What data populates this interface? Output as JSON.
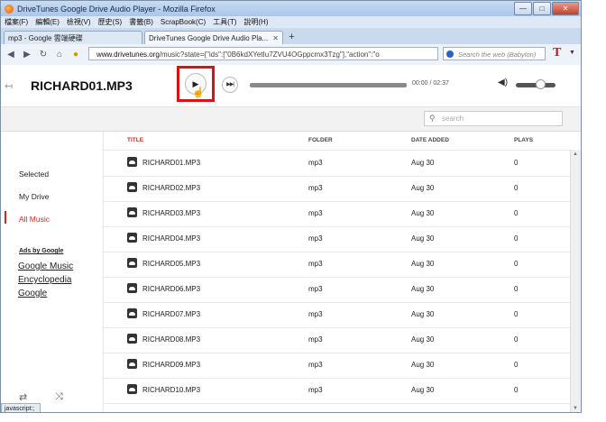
{
  "browser": {
    "window_title": "DriveTunes Google Drive Audio Player - Mozilla Firefox",
    "menu": [
      "檔案(F)",
      "編輯(E)",
      "檢視(V)",
      "歷史(S)",
      "書籤(B)",
      "ScrapBook(C)",
      "工具(T)",
      "說明(H)"
    ],
    "tabs": [
      {
        "label": "mp3 - Google 雲端硬碟"
      },
      {
        "label": "DriveTunes Google Drive Audio Pla..."
      }
    ],
    "url_domain": "www.drivetunes.org",
    "url_path": "/music?state={\"ids\":[\"0B6kdXYetIu7ZVU4OGppcmx3Tzg\"],\"action\":\"o",
    "search_placeholder": "Search the web (Babylon)",
    "status_text": "javascript:;"
  },
  "player": {
    "back_glyph": "↤",
    "song_title": "RICHARD01.MP3",
    "play_glyph": "▶",
    "next_glyph": "▶▶|",
    "time": "00:00 / 02:37",
    "progress": 0,
    "volume": 0.7,
    "volume_glyph": "◀)"
  },
  "search": {
    "placeholder": "search"
  },
  "sidebar": {
    "items": [
      {
        "label": "Selected"
      },
      {
        "label": "My Drive"
      },
      {
        "label": "All Music",
        "active": true
      }
    ],
    "ads_title": "Ads by Google",
    "ads": [
      "Google Music",
      "Encyclopedia",
      "Google"
    ],
    "repeat_glyph": "⇄",
    "shuffle_glyph": "⤨"
  },
  "table": {
    "headers": {
      "title": "TITLE",
      "folder": "FOLDER",
      "date_added": "DATE ADDED",
      "plays": "PLAYS"
    },
    "rows": [
      {
        "title": "RICHARD01.MP3",
        "folder": "mp3",
        "date": "Aug 30",
        "plays": "0"
      },
      {
        "title": "RICHARD02.MP3",
        "folder": "mp3",
        "date": "Aug 30",
        "plays": "0"
      },
      {
        "title": "RICHARD03.MP3",
        "folder": "mp3",
        "date": "Aug 30",
        "plays": "0"
      },
      {
        "title": "RICHARD04.MP3",
        "folder": "mp3",
        "date": "Aug 30",
        "plays": "0"
      },
      {
        "title": "RICHARD05.MP3",
        "folder": "mp3",
        "date": "Aug 30",
        "plays": "0"
      },
      {
        "title": "RICHARD06.MP3",
        "folder": "mp3",
        "date": "Aug 30",
        "plays": "0"
      },
      {
        "title": "RICHARD07.MP3",
        "folder": "mp3",
        "date": "Aug 30",
        "plays": "0"
      },
      {
        "title": "RICHARD08.MP3",
        "folder": "mp3",
        "date": "Aug 30",
        "plays": "0"
      },
      {
        "title": "RICHARD09.MP3",
        "folder": "mp3",
        "date": "Aug 30",
        "plays": "0"
      },
      {
        "title": "RICHARD10.MP3",
        "folder": "mp3",
        "date": "Aug 30",
        "plays": "0"
      }
    ]
  },
  "colors": {
    "accent": "#d9261c",
    "highlight_box": "#e01010"
  }
}
